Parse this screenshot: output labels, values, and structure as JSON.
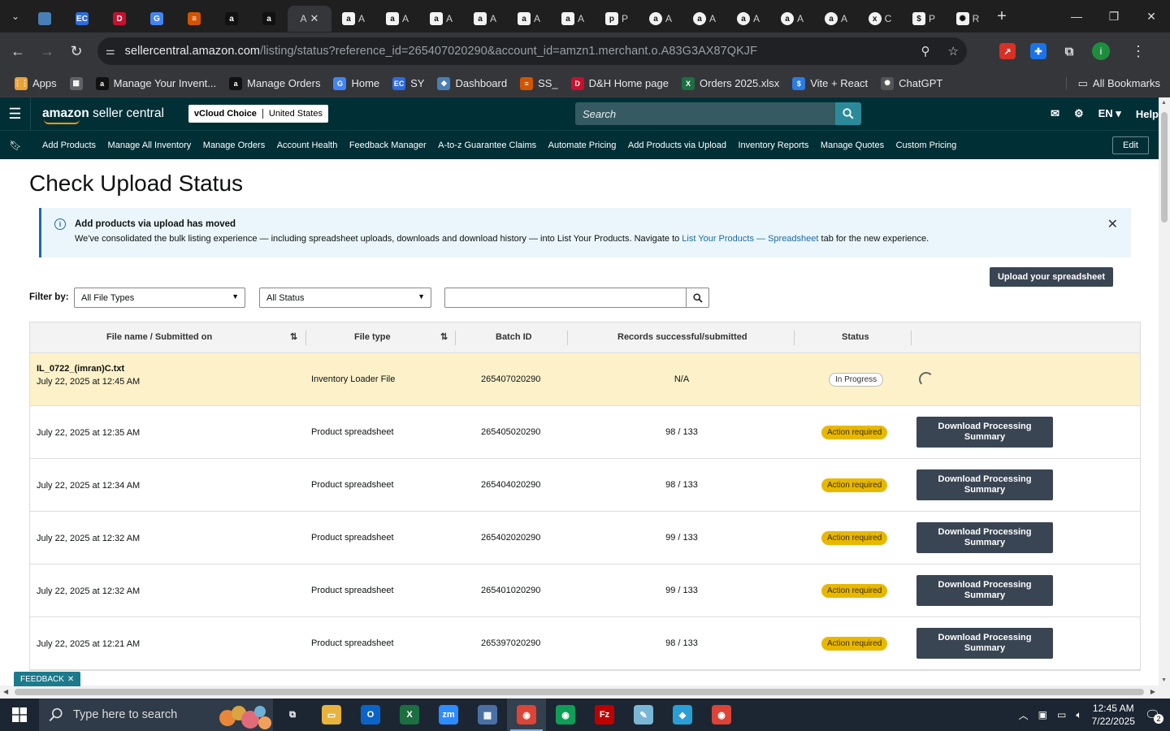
{
  "browser": {
    "tabs": [
      {
        "label": "",
        "icon": "generic-blue-icon",
        "color": "#4a7fb5"
      },
      {
        "label": "",
        "icon": "ec-icon",
        "color": "#2d6cdf",
        "glyph": "EC"
      },
      {
        "label": "",
        "icon": "dh-icon",
        "color": "#c8102e",
        "glyph": "D"
      },
      {
        "label": "",
        "icon": "google-icon",
        "color": "#4285f4",
        "glyph": "G"
      },
      {
        "label": "",
        "icon": "stack-icon",
        "color": "#d35400",
        "glyph": "≡"
      },
      {
        "label": "",
        "icon": "amazon-icon",
        "color": "#111111",
        "glyph": "a"
      },
      {
        "label": "",
        "icon": "amazon-icon",
        "color": "#111111",
        "glyph": "a"
      },
      {
        "label": "A",
        "icon": "",
        "active": true
      },
      {
        "label": "A",
        "icon": "amazon-icon",
        "glyph": "a"
      },
      {
        "label": "A",
        "icon": "amazon-icon",
        "glyph": "a"
      },
      {
        "label": "A",
        "icon": "amazon-icon",
        "glyph": "a"
      },
      {
        "label": "A",
        "icon": "amazon-icon",
        "glyph": "a"
      },
      {
        "label": "A",
        "icon": "amazon-icon",
        "glyph": "a"
      },
      {
        "label": "A",
        "icon": "amazon-icon",
        "glyph": "a"
      },
      {
        "label": "P",
        "icon": "amazon-icon",
        "glyph": "p"
      },
      {
        "label": "A",
        "icon": "amazon-circle-icon",
        "glyph": "a"
      },
      {
        "label": "A",
        "icon": "amazon-circle-icon",
        "glyph": "a"
      },
      {
        "label": "A",
        "icon": "amazon-circle-icon",
        "glyph": "a"
      },
      {
        "label": "A",
        "icon": "amazon-circle-icon",
        "glyph": "a"
      },
      {
        "label": "A",
        "icon": "amazon-circle-icon",
        "glyph": "a"
      },
      {
        "label": "C",
        "icon": "excel-circle-icon",
        "glyph": "x"
      },
      {
        "label": "P",
        "icon": "dollar-icon",
        "glyph": "$"
      },
      {
        "label": "R",
        "icon": "chatgpt-icon",
        "glyph": "✺"
      }
    ],
    "url_host": "sellercentral.amazon.com",
    "url_path": "/listing/status?reference_id=265407020290&account_id=amzn1.merchant.o.A83G3AX87QKJF"
  },
  "bookmarks": {
    "items": [
      {
        "label": "Apps",
        "icon": "apps-grid-icon",
        "color": "#e8a33d",
        "glyph": "⋮⋮"
      },
      {
        "label": "",
        "icon": "tab-groups-icon",
        "color": "#5f6368",
        "glyph": "▦"
      },
      {
        "label": "Manage Your Invent...",
        "icon": "amazon-icon",
        "color": "#111111",
        "glyph": "a"
      },
      {
        "label": "Manage Orders",
        "icon": "amazon-icon",
        "color": "#111111",
        "glyph": "a"
      },
      {
        "label": "Home",
        "icon": "google-icon",
        "color": "#4285f4",
        "glyph": "G"
      },
      {
        "label": "SY",
        "icon": "ec-icon",
        "color": "#2d6cdf",
        "glyph": "EC"
      },
      {
        "label": "Dashboard",
        "icon": "shield-icon",
        "color": "#4a7fb5",
        "glyph": "◆"
      },
      {
        "label": "SS_",
        "icon": "stack-icon",
        "color": "#d35400",
        "glyph": "≡"
      },
      {
        "label": "D&H Home page",
        "icon": "dh-icon",
        "color": "#c8102e",
        "glyph": "D"
      },
      {
        "label": "Orders 2025.xlsx",
        "icon": "excel-icon",
        "color": "#1d6f42",
        "glyph": "X"
      },
      {
        "label": "Vite + React",
        "icon": "dollar-icon",
        "color": "#2d7be0",
        "glyph": "$"
      },
      {
        "label": "ChatGPT",
        "icon": "chatgpt-icon",
        "color": "#555555",
        "glyph": "✺"
      }
    ],
    "all_label": "All Bookmarks"
  },
  "sc": {
    "logo_bold": "amazon",
    "logo_light": " seller central",
    "account_name": "vCloud Choice",
    "account_region": "United States",
    "search_placeholder": "Search",
    "lang": "EN",
    "help": "Help",
    "nav": [
      "Add Products",
      "Manage All Inventory",
      "Manage Orders",
      "Account Health",
      "Feedback Manager",
      "A-to-z Guarantee Claims",
      "Automate Pricing",
      "Add Products via Upload",
      "Inventory Reports",
      "Manage Quotes",
      "Custom Pricing"
    ],
    "edit": "Edit"
  },
  "page": {
    "title": "Check Upload Status",
    "banner_title": "Add products via upload has moved",
    "banner_body": "We've consolidated the bulk listing experience — including spreadsheet uploads, downloads and download history — into List Your Products. Navigate to ",
    "banner_link": "List Your Products — Spreadsheet",
    "banner_tail": " tab for the new experience.",
    "upload_button": "Upload your spreadsheet",
    "filter_label": "Filter by:",
    "filter_type": "All File Types",
    "filter_status": "All Status",
    "search_value": "",
    "columns": [
      "File name / Submitted on",
      "File type",
      "Batch ID",
      "Records successful/submitted",
      "Status"
    ],
    "rows": [
      {
        "file": "IL_0722_(imran)C.txt",
        "date": "July 22, 2025 at 12:45 AM",
        "type": "Inventory Loader File",
        "batch": "265407020290",
        "records": "N/A",
        "status": "In Progress",
        "action": ""
      },
      {
        "file": "",
        "date": "July 22, 2025 at 12:35 AM",
        "type": "Product spreadsheet",
        "batch": "265405020290",
        "records": "98 / 133",
        "status": "Action required",
        "action": "Download Processing Summary"
      },
      {
        "file": "",
        "date": "July 22, 2025 at 12:34 AM",
        "type": "Product spreadsheet",
        "batch": "265404020290",
        "records": "98 / 133",
        "status": "Action required",
        "action": "Download Processing Summary"
      },
      {
        "file": "",
        "date": "July 22, 2025 at 12:32 AM",
        "type": "Product spreadsheet",
        "batch": "265402020290",
        "records": "99 / 133",
        "status": "Action required",
        "action": "Download Processing Summary"
      },
      {
        "file": "",
        "date": "July 22, 2025 at 12:32 AM",
        "type": "Product spreadsheet",
        "batch": "265401020290",
        "records": "99 / 133",
        "status": "Action required",
        "action": "Download Processing Summary"
      },
      {
        "file": "",
        "date": "July 22, 2025 at 12:21 AM",
        "type": "Product spreadsheet",
        "batch": "265397020290",
        "records": "98 / 133",
        "status": "Action required",
        "action": "Download Processing Summary"
      }
    ],
    "feedback": "FEEDBACK"
  },
  "taskbar": {
    "search_placeholder": "Type here to search",
    "apps": [
      {
        "name": "task-view-icon",
        "color": "#1c2633",
        "glyph": "⧉"
      },
      {
        "name": "file-explorer-icon",
        "color": "#e8b33d",
        "glyph": "▭"
      },
      {
        "name": "outlook-icon",
        "color": "#0a64c8",
        "glyph": "O"
      },
      {
        "name": "excel-icon",
        "color": "#1d6f42",
        "glyph": "X"
      },
      {
        "name": "zoom-icon",
        "color": "#2d8cff",
        "glyph": "zm"
      },
      {
        "name": "calculator-icon",
        "color": "#4a6fa5",
        "glyph": "▦"
      },
      {
        "name": "chrome-icon",
        "color": "#db4437",
        "glyph": "◉",
        "active": true
      },
      {
        "name": "chrome-icon",
        "color": "#0f9d58",
        "glyph": "◉"
      },
      {
        "name": "filezilla-icon",
        "color": "#bf0000",
        "glyph": "Fz"
      },
      {
        "name": "notepad-icon",
        "color": "#7ab7d6",
        "glyph": "✎"
      },
      {
        "name": "app-diamond-icon",
        "color": "#2a9fd6",
        "glyph": "◆"
      },
      {
        "name": "chrome-profile-icon",
        "color": "#db4437",
        "glyph": "◉"
      }
    ],
    "time": "12:45 AM",
    "date": "7/22/2025",
    "notif_count": "2"
  }
}
